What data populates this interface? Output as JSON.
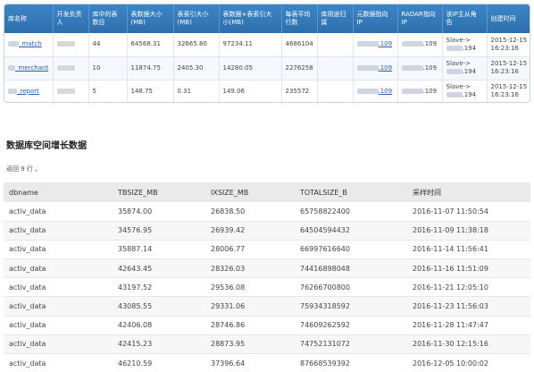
{
  "top_table": {
    "headers": [
      "库名称",
      "开发负责人",
      "库中的表数目",
      "表数据大小(MB)",
      "表索引大小(MB)",
      "表数据+表索引大小(MB)",
      "每表平均行数",
      "库用途归属",
      "元数据指向IP",
      "RADAR指向IP",
      "该IP主从角色",
      "创建时间"
    ],
    "rows": [
      {
        "name": "_match",
        "tables": "44",
        "data": "64568.31",
        "index": "32665.80",
        "total": "97234.11",
        "avg": "4686104",
        "purpose": "",
        "meta_ip": ".109",
        "radar_ip": ".109",
        "role": "Slave->",
        "role_ip": ".194",
        "date": "2015-12-15",
        "time": "16:23:16"
      },
      {
        "name": "_merchant",
        "tables": "10",
        "data": "11874.75",
        "index": "2405.30",
        "total": "14280.05",
        "avg": "2276258",
        "purpose": "",
        "meta_ip": ".109",
        "radar_ip": ".109",
        "role": "Slave->",
        "role_ip": ".194",
        "date": "2015-12-15",
        "time": "16:23:16"
      },
      {
        "name": "_report",
        "tables": "5",
        "data": "148.75",
        "index": "0.31",
        "total": "149.06",
        "avg": "235572",
        "purpose": "",
        "meta_ip": ".109",
        "radar_ip": ".109",
        "role": "Slave->",
        "role_ip": ".194",
        "date": "2015-12-15",
        "time": "16:23:16"
      }
    ]
  },
  "section_title": "数据库空间增长数据",
  "rows_info": "返回 9 行 。",
  "bottom_table": {
    "headers": [
      "dbname",
      "TBSIZE_MB",
      "IXSIZE_MB",
      "TOTALSIZE_B",
      "采样时间"
    ],
    "rows": [
      [
        "activ_data",
        "35874.00",
        "26838.50",
        "65758822400",
        "2016-11-07 11:50:54"
      ],
      [
        "activ_data",
        "34576.95",
        "26939.42",
        "64504594432",
        "2016-11-09 11:38:18"
      ],
      [
        "activ_data",
        "35887.14",
        "28006.77",
        "66997616640",
        "2016-11-14 11:56:41"
      ],
      [
        "activ_data",
        "42643.45",
        "28326.03",
        "74416898048",
        "2016-11-16 11:51:09"
      ],
      [
        "activ_data",
        "43197.52",
        "29536.08",
        "76266700800",
        "2016-11-21 12:05:10"
      ],
      [
        "activ_data",
        "43085.55",
        "29331.06",
        "75934318592",
        "2016-11-23 11:56:03"
      ],
      [
        "activ_data",
        "42406.08",
        "28746.86",
        "74609262592",
        "2016-11-28 11:47:47"
      ],
      [
        "activ_data",
        "42415.23",
        "28873.95",
        "74752131072",
        "2016-11-30 12:15:16"
      ],
      [
        "activ_data",
        "46210.59",
        "37396.64",
        "87668539392",
        "2016-12-05 10:00:02"
      ]
    ]
  }
}
